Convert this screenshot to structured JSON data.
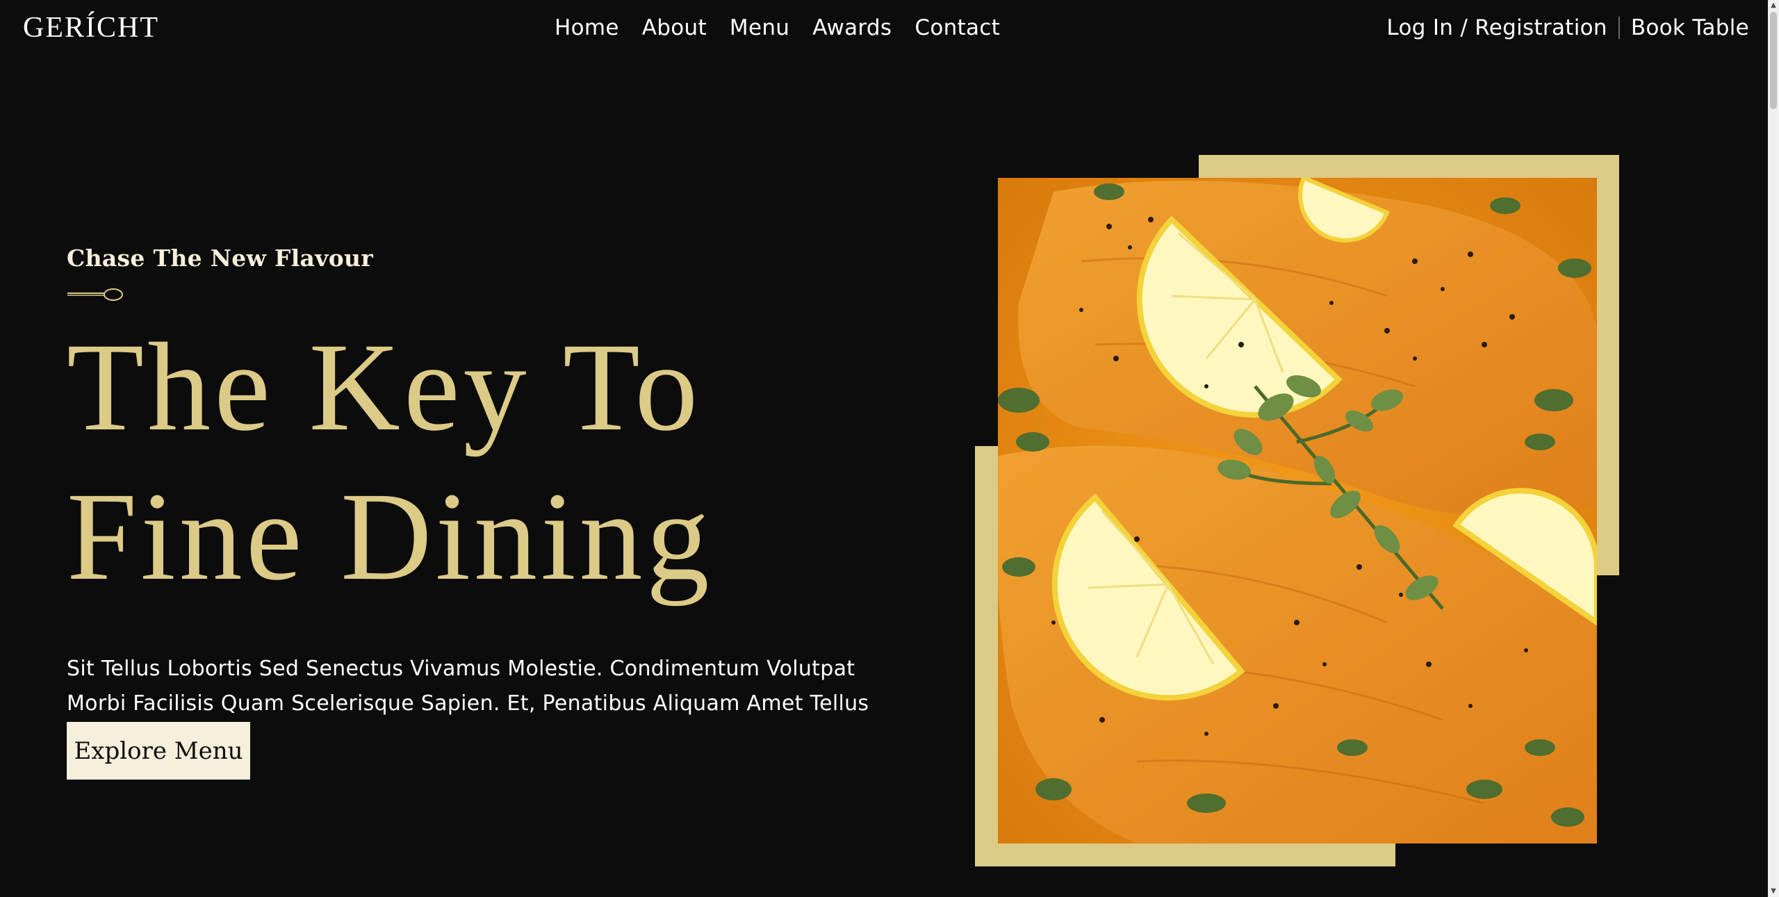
{
  "header": {
    "logo": "GERÍCHT",
    "nav": [
      {
        "label": "Home"
      },
      {
        "label": "About"
      },
      {
        "label": "Menu"
      },
      {
        "label": "Awards"
      },
      {
        "label": "Contact"
      }
    ],
    "login_label": "Log In / Registration",
    "book_label": "Book Table"
  },
  "hero": {
    "subtitle": "Chase The New Flavour",
    "headline_line1": "The Key To",
    "headline_line2": "Fine Dining",
    "description": "Sit Tellus Lobortis Sed Senectus Vivamus Molestie. Condimentum Volutpat Morbi Facilisis Quam Scelerisque Sapien. Et, Penatibus Aliquam Amet Tellus",
    "button_label": "Explore Menu",
    "image_icon": "salmon-dish-image"
  },
  "colors": {
    "background": "#0c0c0c",
    "gold": "#dcca87",
    "cream": "#f5efdb",
    "white": "#ffffff"
  }
}
